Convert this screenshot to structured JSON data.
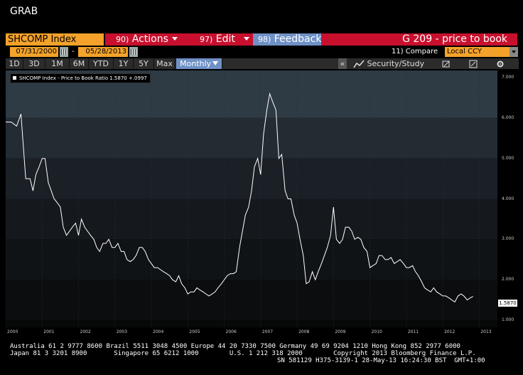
{
  "window_title": "GRAB",
  "toolbar": {
    "ticker": "SHCOMP Index",
    "actions_num": "90)",
    "actions_label": "Actions",
    "edit_num": "97)",
    "edit_label": "Edit",
    "feedback_num": "98)",
    "feedback_label": "Feedback",
    "function_title": "G 209 - price to book"
  },
  "dates": {
    "start": "07/31/2000",
    "end": "05/28/2013",
    "separator": "-",
    "compare_label": "11) Compare",
    "currency": "Local CCY"
  },
  "periods": [
    "1D",
    "3D",
    "1M",
    "6M",
    "YTD",
    "1Y",
    "5Y",
    "Max"
  ],
  "frequency": "Monthly",
  "right_tools": {
    "collapse": "«",
    "security_study": "Security/Study"
  },
  "chart_data": {
    "type": "line",
    "legend": "SHCOMP Index - Price to Book Ratio 1.5870 +.0997",
    "last_value": "1.5870",
    "y_ticks": [
      "7.000",
      "6.000",
      "5.000",
      "4.000",
      "3.000",
      "2.000",
      "1.000"
    ],
    "x_ticks": [
      "2000",
      "2001",
      "2002",
      "2003",
      "2004",
      "2005",
      "2006",
      "2007",
      "2008",
      "2009",
      "2010",
      "2011",
      "2012",
      "2013"
    ],
    "ylim": [
      1.0,
      7.0
    ],
    "xlim": [
      2000.0,
      2013.5
    ],
    "x": [
      2000.0,
      2000.15,
      2000.3,
      2000.42,
      2000.55,
      2000.67,
      2000.75,
      2000.83,
      2000.92,
      2001.0,
      2001.08,
      2001.17,
      2001.25,
      2001.33,
      2001.42,
      2001.5,
      2001.58,
      2001.67,
      2001.75,
      2001.83,
      2001.92,
      2002.0,
      2002.08,
      2002.17,
      2002.25,
      2002.33,
      2002.42,
      2002.5,
      2002.58,
      2002.67,
      2002.75,
      2002.83,
      2002.92,
      2003.0,
      2003.08,
      2003.17,
      2003.25,
      2003.33,
      2003.42,
      2003.5,
      2003.58,
      2003.67,
      2003.75,
      2003.83,
      2003.92,
      2004.0,
      2004.08,
      2004.17,
      2004.25,
      2004.33,
      2004.42,
      2004.5,
      2004.58,
      2004.67,
      2004.75,
      2004.83,
      2004.92,
      2005.0,
      2005.08,
      2005.17,
      2005.25,
      2005.33,
      2005.42,
      2005.5,
      2005.58,
      2005.67,
      2005.75,
      2005.83,
      2005.92,
      2006.0,
      2006.08,
      2006.17,
      2006.25,
      2006.33,
      2006.42,
      2006.5,
      2006.58,
      2006.67,
      2006.75,
      2006.83,
      2006.92,
      2007.0,
      2007.08,
      2007.17,
      2007.25,
      2007.33,
      2007.42,
      2007.5,
      2007.58,
      2007.67,
      2007.75,
      2007.83,
      2007.92,
      2008.0,
      2008.08,
      2008.17,
      2008.25,
      2008.33,
      2008.42,
      2008.5,
      2008.58,
      2008.67,
      2008.75,
      2008.83,
      2008.92,
      2009.0,
      2009.08,
      2009.17,
      2009.25,
      2009.33,
      2009.42,
      2009.5,
      2009.58,
      2009.67,
      2009.75,
      2009.83,
      2009.92,
      2010.0,
      2010.08,
      2010.17,
      2010.25,
      2010.33,
      2010.42,
      2010.5,
      2010.58,
      2010.67,
      2010.75,
      2010.83,
      2010.92,
      2011.0,
      2011.08,
      2011.17,
      2011.25,
      2011.33,
      2011.42,
      2011.5,
      2011.58,
      2011.67,
      2011.75,
      2011.83,
      2011.92,
      2012.0,
      2012.08,
      2012.17,
      2012.25,
      2012.33,
      2012.42,
      2012.5,
      2012.58,
      2012.67,
      2012.75,
      2012.83,
      2012.92,
      2013.0,
      2013.08,
      2013.17,
      2013.25,
      2013.33,
      2013.42
    ],
    "y": [
      5.9,
      5.9,
      5.8,
      6.1,
      4.5,
      4.5,
      4.2,
      4.6,
      4.8,
      5.0,
      5.0,
      4.4,
      4.2,
      4.0,
      3.9,
      3.8,
      3.3,
      3.1,
      3.2,
      3.3,
      3.4,
      3.1,
      3.5,
      3.3,
      3.2,
      3.1,
      3.0,
      2.8,
      2.7,
      2.9,
      2.9,
      3.0,
      2.8,
      2.8,
      2.9,
      2.7,
      2.7,
      2.5,
      2.45,
      2.5,
      2.6,
      2.8,
      2.8,
      2.7,
      2.5,
      2.4,
      2.3,
      2.3,
      2.25,
      2.2,
      2.15,
      2.1,
      2.0,
      1.95,
      2.1,
      1.9,
      1.8,
      1.65,
      1.7,
      1.7,
      1.8,
      1.75,
      1.7,
      1.65,
      1.6,
      1.65,
      1.7,
      1.8,
      1.9,
      2.0,
      2.1,
      2.15,
      2.15,
      2.2,
      2.8,
      3.2,
      3.6,
      3.8,
      4.2,
      4.8,
      5.0,
      4.6,
      5.6,
      6.2,
      6.6,
      6.4,
      6.2,
      5.0,
      5.1,
      4.2,
      4.0,
      4.0,
      3.6,
      3.4,
      3.0,
      2.6,
      1.9,
      1.95,
      2.2,
      2.0,
      2.2,
      2.4,
      2.6,
      2.8,
      3.1,
      3.8,
      3.0,
      2.9,
      3.0,
      3.3,
      3.3,
      3.2,
      3.0,
      3.05,
      3.0,
      2.8,
      2.7,
      2.3,
      2.35,
      2.4,
      2.6,
      2.6,
      2.5,
      2.5,
      2.55,
      2.4,
      2.45,
      2.5,
      2.4,
      2.3,
      2.3,
      2.35,
      2.2,
      2.1,
      1.95,
      1.8,
      1.75,
      1.7,
      1.8,
      1.7,
      1.65,
      1.6,
      1.6,
      1.55,
      1.5,
      1.45,
      1.6,
      1.65,
      1.6,
      1.5,
      1.55,
      1.587
    ]
  },
  "footer": {
    "line1": "Australia 61 2 9777 8600 Brazil 5511 3048 4500 Europe 44 20 7330 7500 Germany 49 69 9204 1210 Hong Kong 852 2977 6000",
    "line2": "Japan 81 3 3201 8900       Singapore 65 6212 1000        U.S. 1 212 318 2000        Copyright 2013 Bloomberg Finance L.P.",
    "line3": "SN 581129 H375-3139-1 28-May-13 16:24:30 BST  GMT+1:00"
  }
}
